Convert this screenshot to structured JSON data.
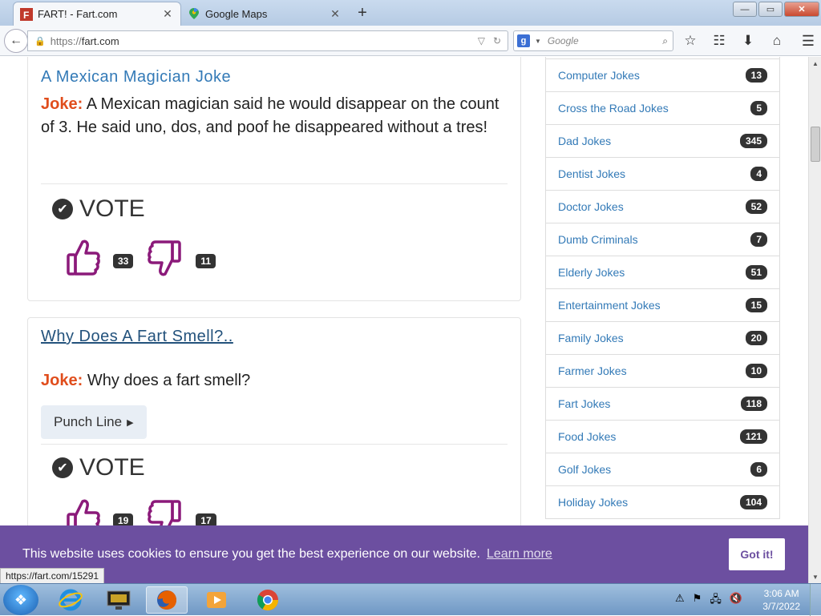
{
  "browser": {
    "tabs": [
      {
        "title": "FART! - Fart.com",
        "close": "✕"
      },
      {
        "title": "Google Maps",
        "close": "✕"
      }
    ],
    "new_tab": "+",
    "url_protocol": "https://",
    "url_host": "fart.com",
    "search_placeholder": "Google",
    "window_buttons": {
      "minimize": "—",
      "maximize": "▭",
      "close": "✕"
    }
  },
  "jokes": [
    {
      "title": "A Mexican Magician Joke",
      "label": "Joke:",
      "text": "A Mexican magician said he would disappear on the count of 3. He said uno, dos, and poof he disappeared without a tres!",
      "vote_label": "VOTE",
      "upvotes": "33",
      "downvotes": "11"
    },
    {
      "title": "Why Does A Fart Smell?..",
      "label": "Joke:",
      "text": "Why does a fart smell?",
      "punch_label": "Punch Line",
      "vote_label": "VOTE",
      "upvotes": "19",
      "downvotes": "17"
    }
  ],
  "categories": [
    {
      "name": "Computer Jokes",
      "count": "13"
    },
    {
      "name": "Cross the Road Jokes",
      "count": "5"
    },
    {
      "name": "Dad Jokes",
      "count": "345"
    },
    {
      "name": "Dentist Jokes",
      "count": "4"
    },
    {
      "name": "Doctor Jokes",
      "count": "52"
    },
    {
      "name": "Dumb Criminals",
      "count": "7"
    },
    {
      "name": "Elderly Jokes",
      "count": "51"
    },
    {
      "name": "Entertainment Jokes",
      "count": "15"
    },
    {
      "name": "Family Jokes",
      "count": "20"
    },
    {
      "name": "Farmer Jokes",
      "count": "10"
    },
    {
      "name": "Fart Jokes",
      "count": "118"
    },
    {
      "name": "Food Jokes",
      "count": "121"
    },
    {
      "name": "Golf Jokes",
      "count": "6"
    },
    {
      "name": "Holiday Jokes",
      "count": "104"
    }
  ],
  "cookie": {
    "message": "This website uses cookies to ensure you get the best experience on our website.",
    "learn_more": "Learn more",
    "button": "Got it!"
  },
  "status_url": "https://fart.com/15291",
  "taskbar": {
    "time": "3:06 AM",
    "date": "3/7/2022"
  },
  "colors": {
    "link": "#337ab7",
    "joke_label": "#e04d1c",
    "thumb": "#8b1a7a",
    "cookie_bg": "#6c4fa0"
  }
}
